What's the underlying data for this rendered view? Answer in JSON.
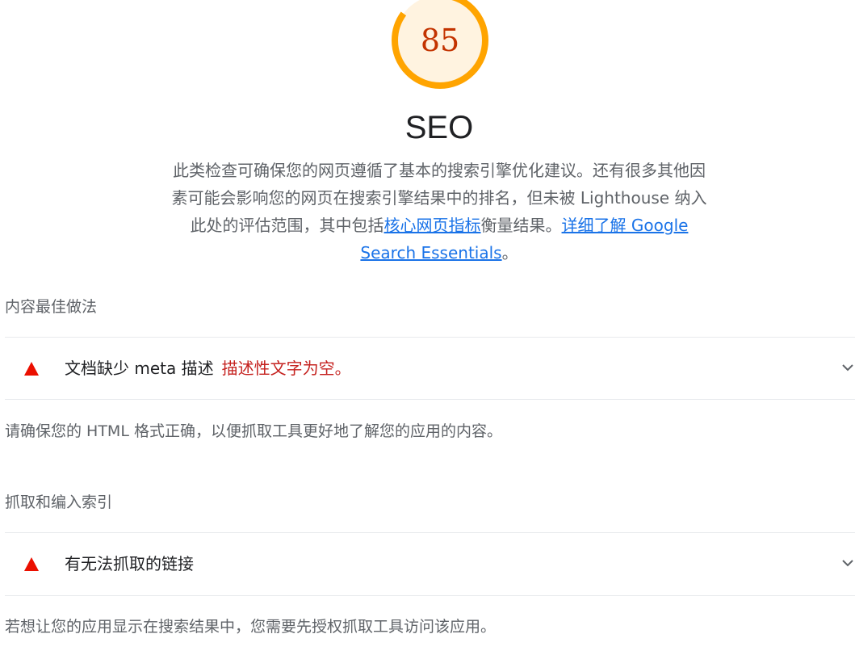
{
  "gauge": {
    "score": "85",
    "score_fraction": 0.85,
    "color": "#ffa400",
    "track_color": "#fff3e0",
    "text_color": "#c33300"
  },
  "category": {
    "title": "SEO",
    "desc_part1": "此类检查可确保您的网页遵循了基本的搜索引擎优化建议。还有很多其他因素可能会影响您的网页在搜索引擎结果中的排名，但未被 Lighthouse 纳入此处的评估范围，其中包括",
    "link1": "核心网页指标",
    "desc_part2": "衡量结果。",
    "link2": "详细了解 Google Search Essentials",
    "desc_end": "。"
  },
  "groups": [
    {
      "title": "内容最佳做法",
      "audits": [
        {
          "title": "文档缺少 meta 描述",
          "display_value": "描述性文字为空。",
          "chevron": "chevron-down-icon"
        }
      ],
      "description": "请确保您的 HTML 格式正确，以便抓取工具更好地了解您的应用的内容。"
    },
    {
      "title": "抓取和编入索引",
      "audits": [
        {
          "title": "有无法抓取的链接",
          "display_value": "",
          "chevron": "chevron-down-icon"
        }
      ],
      "description": "若想让您的应用显示在搜索结果中，您需要先授权抓取工具访问该应用。"
    }
  ],
  "colors": {
    "fail": "#eb0f00",
    "link": "#1a73e8",
    "display_value": "#c5221f"
  }
}
